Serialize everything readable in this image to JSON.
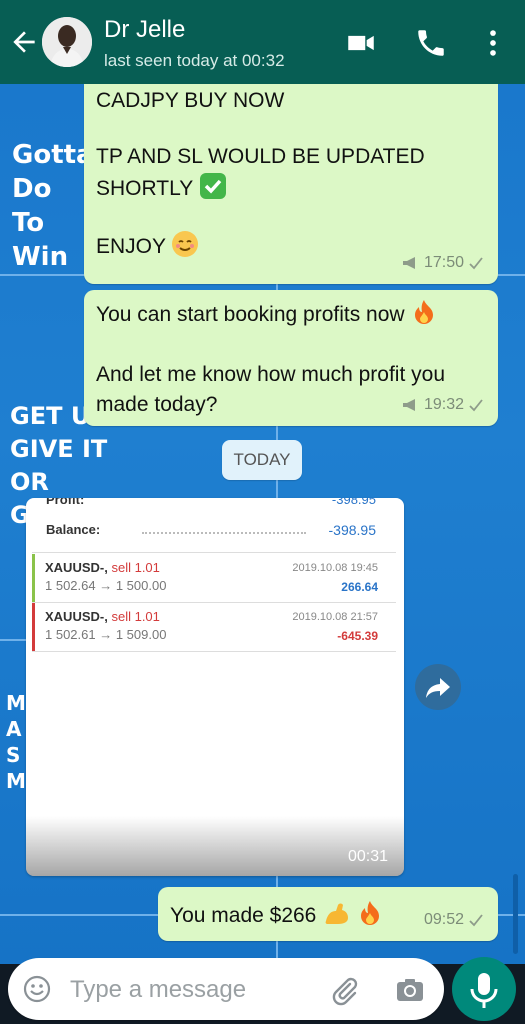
{
  "header": {
    "contact_name": "Dr Jelle",
    "last_seen": "last seen today at 00:32"
  },
  "wallpaper": {
    "left_text": [
      "Gotta",
      "Do",
      "To",
      "Win"
    ],
    "left_text2": [
      "GET UP",
      "GIVE IT",
      "OR",
      "G"
    ],
    "left_text3": [
      "M",
      "A",
      "S",
      "M"
    ]
  },
  "messages": [
    {
      "lines": [
        "CADJPY BUY NOW",
        "",
        "TP AND SL WOULD BE UPDATED",
        "SHORTLY",
        "",
        "ENJOY"
      ],
      "time": "17:50"
    },
    {
      "lines": [
        "You can start booking profits now",
        "",
        "And let me know how much profit you",
        "made today?"
      ],
      "time": "19:32"
    }
  ],
  "date_divider": "TODAY",
  "image_message": {
    "profit_label": "Profit:",
    "profit_value": "-398.95",
    "balance_label": "Balance:",
    "balance_value": "-398.95",
    "trades": [
      {
        "symbol": "XAUUSD-,",
        "side": "sell 1.01",
        "prices": "1 502.64 → 1 500.00",
        "date": "2019.10.08 19:45",
        "pl": "266.64",
        "color": "#2a74c8"
      },
      {
        "symbol": "XAUUSD-,",
        "side": "sell 1.01",
        "prices": "1 502.61 → 1 509.00",
        "date": "2019.10.08 21:57",
        "pl": "-645.39",
        "color": "#d33b3b"
      }
    ],
    "duration": "00:31"
  },
  "last_message": {
    "text": "You made $266",
    "time": "09:52"
  },
  "input": {
    "placeholder": "Type a message"
  },
  "colors": {
    "header": "#075e54",
    "bubble": "#dcf8c6",
    "mic": "#00897b"
  }
}
